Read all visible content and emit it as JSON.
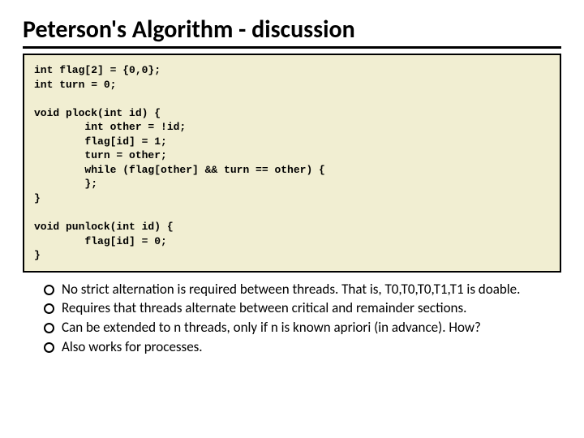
{
  "title": "Peterson's Algorithm - discussion",
  "code": "int flag[2] = {0,0};\nint turn = 0;\n\nvoid plock(int id) {\n        int other = !id;\n        flag[id] = 1;\n        turn = other;\n        while (flag[other] && turn == other) {\n        };\n}\n\nvoid punlock(int id) {\n        flag[id] = 0;\n}",
  "bullets": [
    "No strict alternation is required between threads.  That is, T0,T0,T0,T1,T1 is doable.",
    "Requires that threads alternate between critical and remainder sections.",
    "Can be extended to n threads, only if n is known apriori (in advance). How?",
    "Also works for processes."
  ]
}
